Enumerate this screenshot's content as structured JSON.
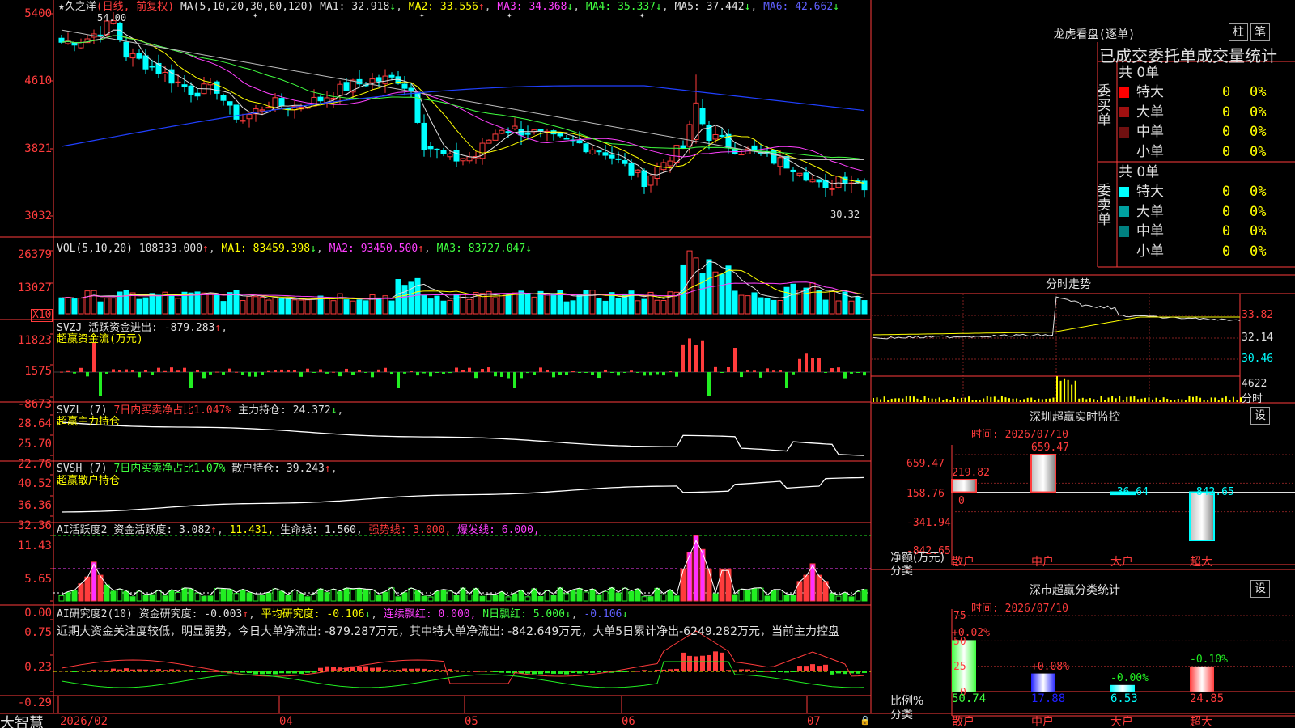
{
  "stock": {
    "name": "★久之洋",
    "mode": "(日线, 前复权)",
    "ma_label": "MA(5,10,20,30,60,120)",
    "ma1": "MA1: 32.918",
    "ma2": "MA2: 33.556",
    "ma3": "MA3: 34.368",
    "ma4": "MA4: 35.337",
    "ma5": "MA5: 37.442",
    "ma6": "MA6: 42.662",
    "hi_mark": "54.00",
    "lo_mark": "30.32"
  },
  "price_axis": [
    "5400",
    "4610",
    "3821",
    "3032"
  ],
  "vol": {
    "label": "VOL(5,10,20)",
    "value": "108333.000",
    "ma1": "MA1: 83459.398",
    "ma2": "MA2: 93450.500",
    "ma3": "MA3: 83727.047",
    "axis": [
      "26379",
      "13027"
    ],
    "unit": "X10"
  },
  "svzj": {
    "label": "SVZJ  活跃资金进出: -879.283",
    "sub": "超赢资金流(万元)",
    "axis": [
      "11823",
      "1575",
      "-8673"
    ]
  },
  "svzl": {
    "label": "SVZL (7)",
    "ratio": "7日内买卖净占比1.047%",
    "hold": "主力持仓: 24.372",
    "sub": "超赢主力持仓",
    "axis": [
      "28.64",
      "25.70",
      "22.76"
    ]
  },
  "svsh": {
    "label": "SVSH (7)",
    "ratio": "7日内买卖净占比1.07%",
    "hold": "散户持仓: 39.243",
    "sub": "超赢散户持仓",
    "axis": [
      "40.52",
      "36.36",
      "32.36"
    ]
  },
  "ai1": {
    "label": "AI活跃度2",
    "a": "资金活跃度: 3.082",
    "b": "11.431,",
    "c": "生命线: 1.560,",
    "d": "强势线: 3.000,",
    "e": "爆发线: 6.000,",
    "axis": [
      "11.43",
      "5.65",
      "0.00"
    ]
  },
  "ai2": {
    "label": "AI研究度2(10)",
    "a": "资金研究度: -0.003",
    "b": "平均研究度: -0.106",
    "c": "连续飘红: 0.000,",
    "d": "N日飘红: 5.000",
    "e": "-0.106",
    "text": "近期大资金关注度较低，明显弱势，今日大单净流出: -879.287万元，其中特大单净流出: -842.649万元，大单5日累计净出-6249.282万元，当前主力控盘",
    "axis": [
      "0.75",
      "0.23",
      "-0.29"
    ]
  },
  "xaxis": {
    "start": "2026/02",
    "labels": [
      "04",
      "05",
      "06",
      "07"
    ]
  },
  "brand": "大智慧",
  "right": {
    "lhb_title": "龙虎看盘(逐单)",
    "btn1": "柱",
    "btn2": "笔",
    "order_title": "已成交委托单成交量统计",
    "buy_label": "委买单",
    "sell_label": "委卖单",
    "buy_total": "共 0单",
    "sell_total": "共 0单",
    "buy_rows": [
      {
        "name": "特大",
        "color": "#ff0000",
        "val": "0",
        "pct": "0%"
      },
      {
        "name": "大单",
        "color": "#a01010",
        "val": "0",
        "pct": "0%"
      },
      {
        "name": "中单",
        "color": "#701010",
        "val": "0",
        "pct": "0%"
      },
      {
        "name": "小单",
        "color": "#000000",
        "val": "0",
        "pct": "0%"
      }
    ],
    "sell_rows": [
      {
        "name": "特大",
        "color": "#00ffff",
        "val": "0",
        "pct": "0%"
      },
      {
        "name": "大单",
        "color": "#00a0a0",
        "val": "0",
        "pct": "0%"
      },
      {
        "name": "中单",
        "color": "#008080",
        "val": "0",
        "pct": "0%"
      },
      {
        "name": "小单",
        "color": "#000000",
        "val": "0",
        "pct": "0%"
      }
    ],
    "fs_title": "分时走势",
    "fs_axis": [
      "33.82",
      "32.14",
      "30.46"
    ],
    "fs_vol": "4622",
    "fs_vol_unit": "分时",
    "sz_title": "深圳超赢实时监控",
    "set": "设",
    "sz_time": "时间: 2026/07/10",
    "sz_axis": [
      "659.47",
      "158.76",
      "0",
      "-341.94",
      "-842.65"
    ],
    "sz_bars": [
      {
        "cat": "散户",
        "val": 219.82,
        "label": "219.82"
      },
      {
        "cat": "中户",
        "val": 659.47,
        "label": "659.47"
      },
      {
        "cat": "大户",
        "val": -36.64,
        "label": "-36.64"
      },
      {
        "cat": "超大",
        "val": -842.65,
        "label": "-842.65"
      }
    ],
    "sz_ylab": "净额(万元)",
    "sz_xlab": "分类",
    "cls_title": "深市超赢分类统计",
    "cls_time": "时间: 2026/07/10",
    "cls_axis": [
      "75",
      "50",
      "25",
      "0"
    ],
    "cls_bars": [
      {
        "cat": "散户",
        "pct": "+0.02%",
        "val": 50.74,
        "label": "50.74"
      },
      {
        "cat": "中户",
        "pct": "+0.08%",
        "val": 17.88,
        "label": "17.88"
      },
      {
        "cat": "大户",
        "pct": "-0.00%",
        "val": 6.53,
        "label": "6.53"
      },
      {
        "cat": "超大",
        "pct": "-0.10%",
        "val": 24.85,
        "label": "24.85"
      }
    ],
    "cls_ylab": "比例%",
    "cls_xlab": "分类"
  },
  "chart_data": [
    {
      "type": "bar",
      "title": "深圳超赢实时监控",
      "categories": [
        "散户",
        "中户",
        "大户",
        "超大"
      ],
      "values": [
        219.82,
        659.47,
        -36.64,
        -842.65
      ],
      "ylabel": "净额(万元)",
      "xlabel": "分类",
      "ylim": [
        -842.65,
        659.47
      ]
    },
    {
      "type": "bar",
      "title": "深市超赢分类统计",
      "categories": [
        "散户",
        "中户",
        "大户",
        "超大"
      ],
      "values": [
        50.74,
        17.88,
        6.53,
        24.85
      ],
      "ylabel": "比例%",
      "xlabel": "分类",
      "ylim": [
        0,
        75
      ]
    }
  ]
}
